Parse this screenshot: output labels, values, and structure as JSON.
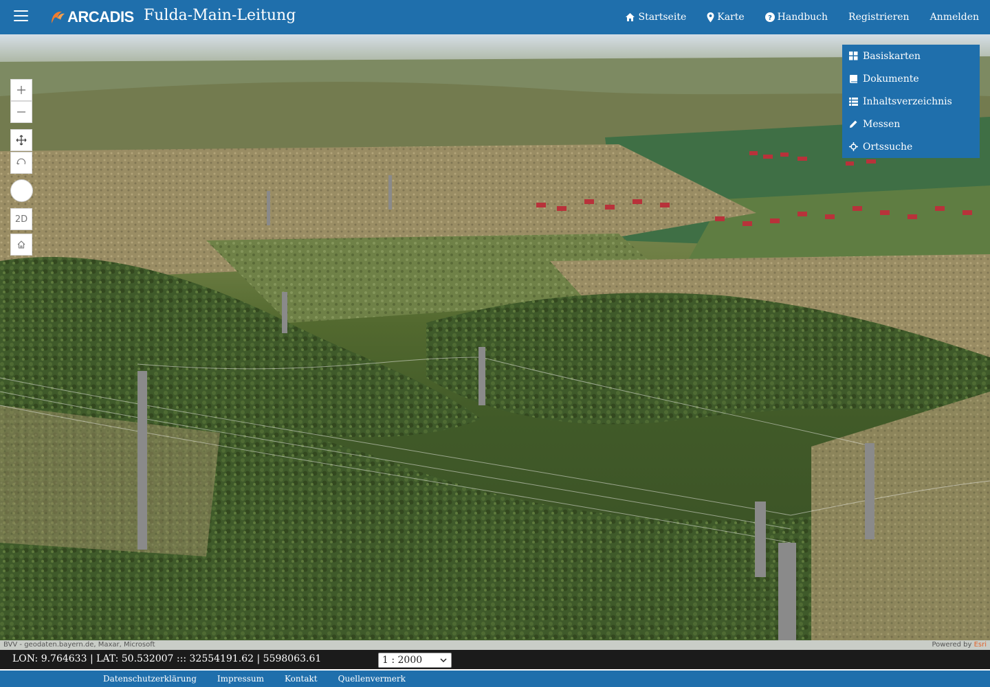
{
  "header": {
    "logo_text": "ARCADIS",
    "app_title": "Fulda-Main-Leitung",
    "nav": [
      {
        "label": "Startseite",
        "icon": "home-icon"
      },
      {
        "label": "Karte",
        "icon": "map-marker-icon"
      },
      {
        "label": "Handbuch",
        "icon": "question-circle-icon"
      },
      {
        "label": "Registrieren",
        "icon": ""
      },
      {
        "label": "Anmelden",
        "icon": ""
      }
    ]
  },
  "map_controls": {
    "zoom_in": "+",
    "zoom_out": "−",
    "toggle_2d": "2D"
  },
  "side_menu": {
    "items": [
      {
        "label": "Basiskarten",
        "icon": "grid-icon"
      },
      {
        "label": "Dokumente",
        "icon": "book-icon"
      },
      {
        "label": "Inhaltsverzeichnis",
        "icon": "list-icon"
      },
      {
        "label": "Messen",
        "icon": "pencil-icon"
      },
      {
        "label": "Ortssuche",
        "icon": "crosshair-icon"
      }
    ]
  },
  "attribution": {
    "left": "BVV - geodaten.bayern.de, Maxar, Microsoft",
    "powered_by": "Powered by ",
    "esri": "Esri"
  },
  "coordinates": {
    "text": "LON: 9.764633 | LAT: 50.532007 ::: 32554191.62 | 5598063.61"
  },
  "scale": {
    "selected": "1 : 2000"
  },
  "footer": {
    "links": [
      "Datenschutzerklärung",
      "Impressum",
      "Kontakt",
      "Quellenvermerk"
    ]
  },
  "colors": {
    "brand_blue": "#1f6fac",
    "esri_orange": "#e2632b",
    "coord_bar": "#1b1b1b"
  }
}
